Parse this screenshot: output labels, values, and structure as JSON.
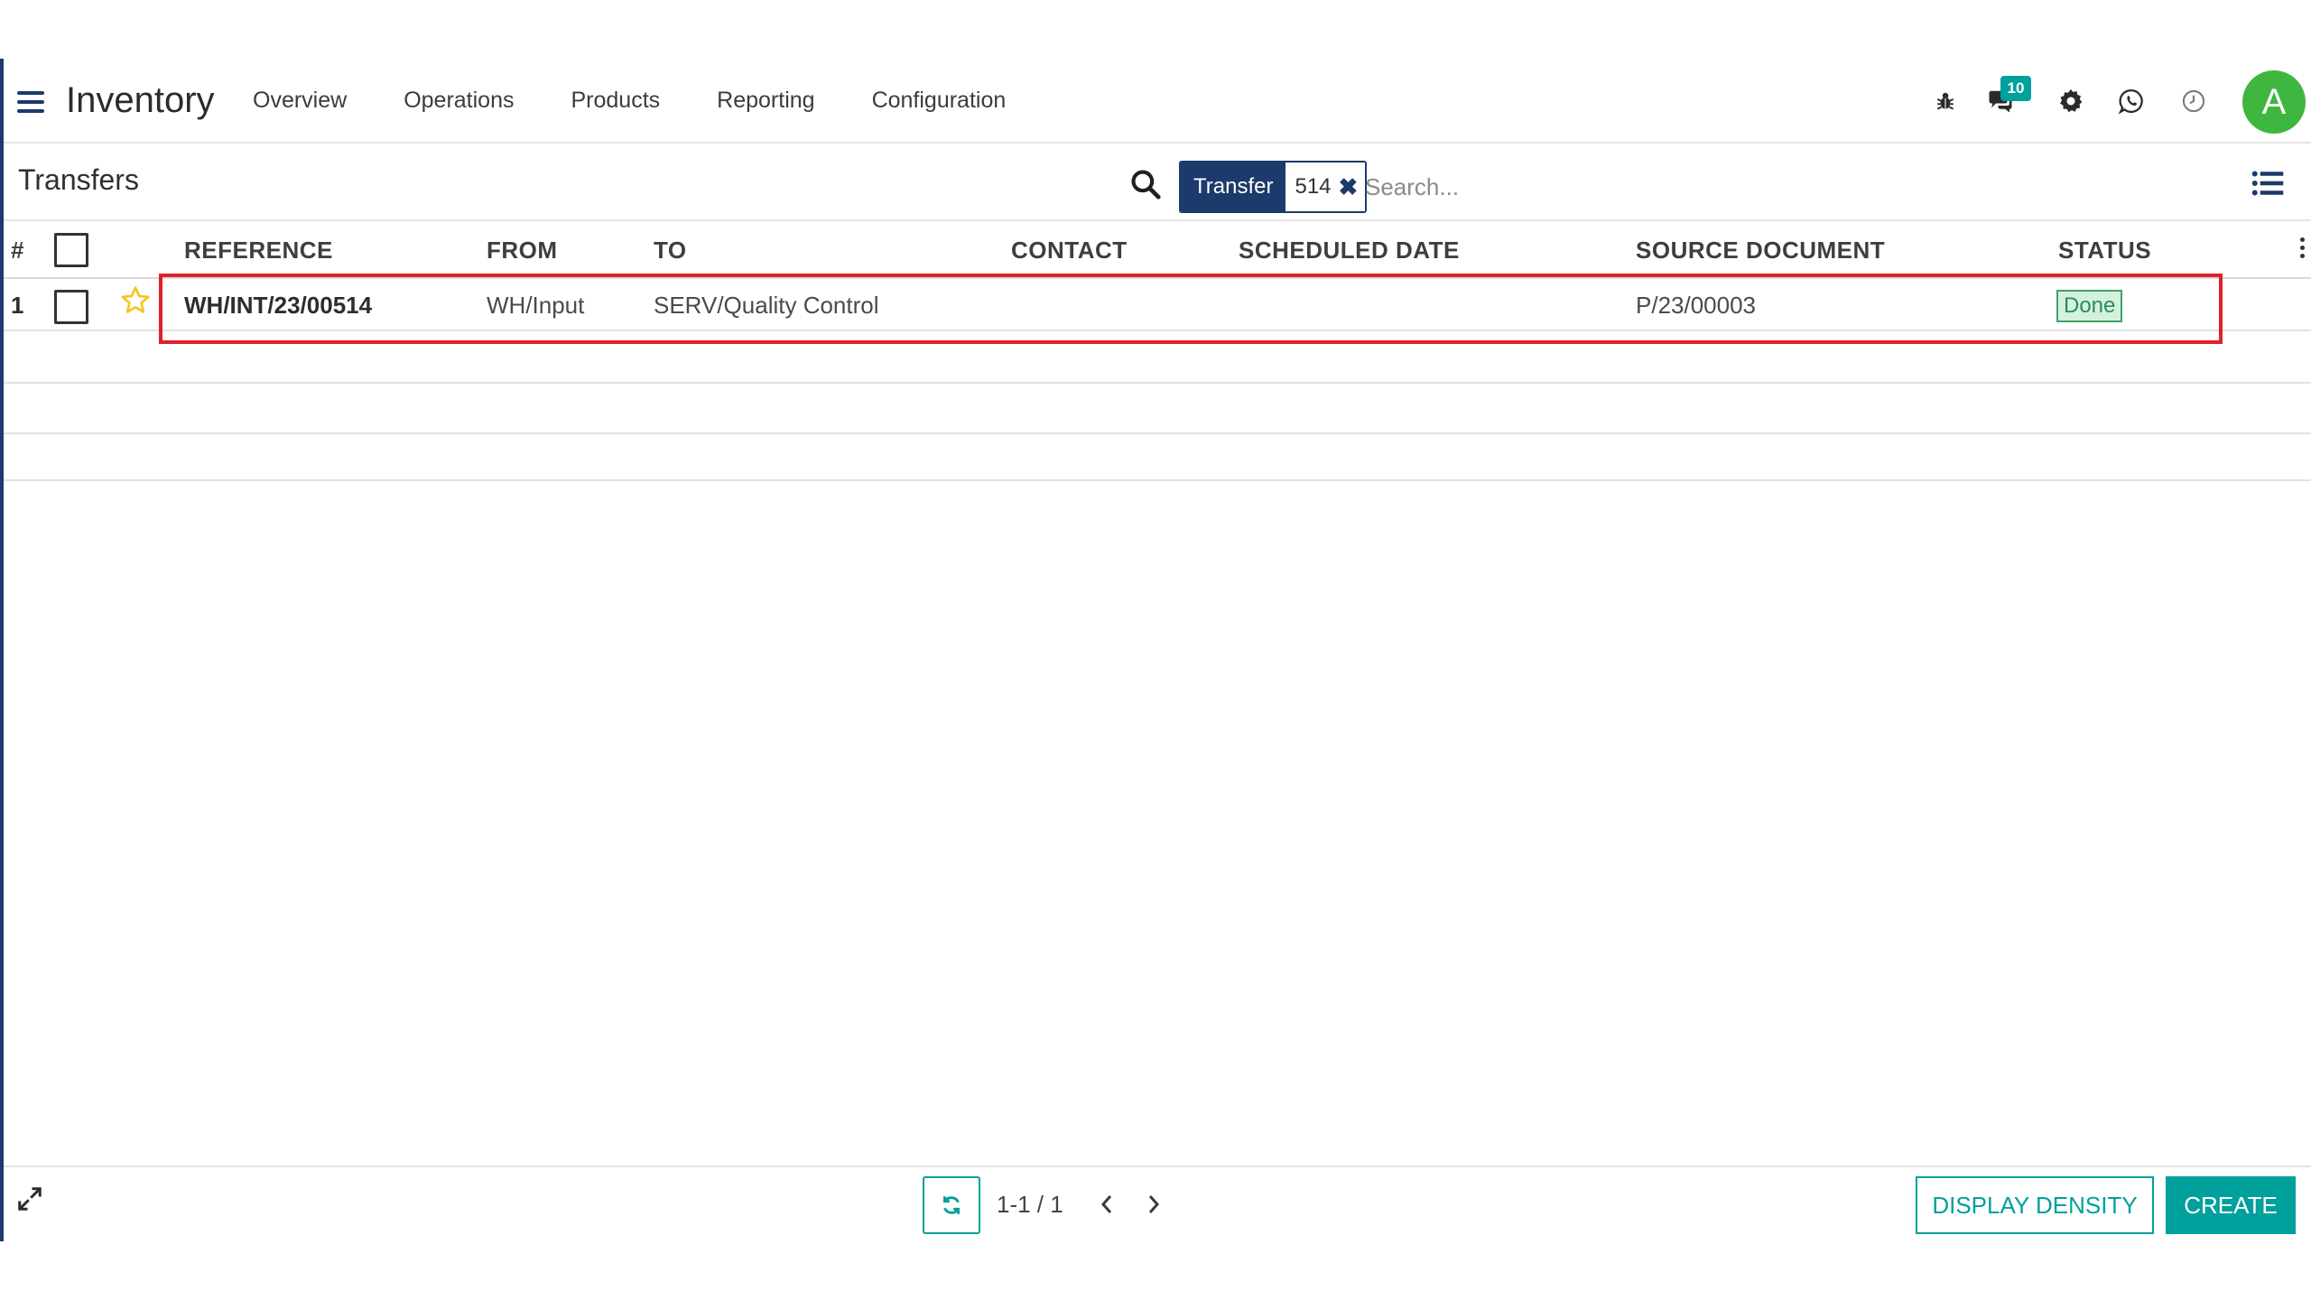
{
  "navbar": {
    "app_title": "Inventory",
    "menu": [
      "Overview",
      "Operations",
      "Products",
      "Reporting",
      "Configuration"
    ],
    "messages_badge": "10",
    "avatar_initial": "A",
    "icons": [
      "bug-icon",
      "chat-icon",
      "gear-icon",
      "whatsapp-icon",
      "clock-icon"
    ]
  },
  "control_panel": {
    "breadcrumb": "Transfers",
    "facet": {
      "label": "Transfer",
      "value": "514"
    },
    "search_placeholder": "Search..."
  },
  "table": {
    "columns": {
      "index": "#",
      "reference": "REFERENCE",
      "from": "FROM",
      "to": "TO",
      "contact": "CONTACT",
      "scheduled_date": "SCHEDULED DATE",
      "source_document": "SOURCE DOCUMENT",
      "status": "STATUS"
    },
    "rows": [
      {
        "index": "1",
        "reference": "WH/INT/23/00514",
        "from": "WH/Input",
        "to": "SERV/Quality Control",
        "contact": "",
        "scheduled_date": "",
        "source_document": "P/23/00003",
        "status": "Done"
      }
    ]
  },
  "footer": {
    "pager_value": "1-1 / 1",
    "display_density_label": "DISPLAY DENSITY",
    "create_label": "CREATE"
  },
  "colors": {
    "brand": "#1c3a6b",
    "accent": "#00a09d",
    "highlight": "#e0202a",
    "status_done": "#2e8b57"
  }
}
